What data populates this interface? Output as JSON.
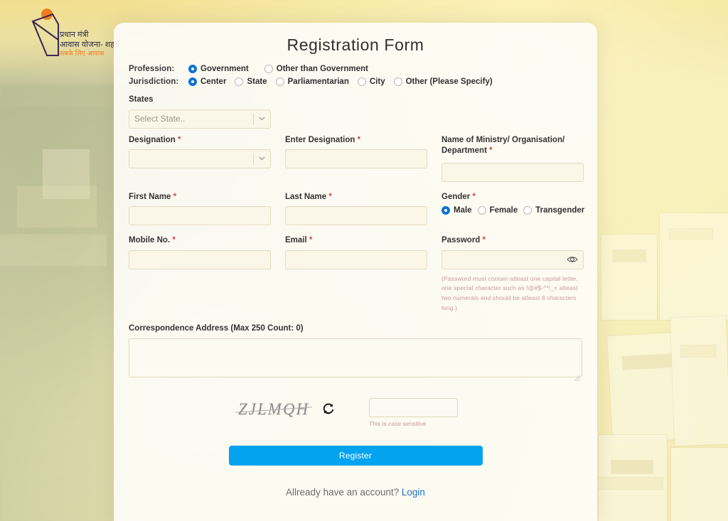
{
  "logo": {
    "name": "pmay-logo",
    "line1": "प्रधान मंत्री",
    "line2": "आवास योजना- शहरी",
    "line3": "सबके लिए आवास"
  },
  "title": "Registration  Form",
  "profession": {
    "label": "Profession:",
    "options": [
      {
        "label": "Government",
        "selected": true
      },
      {
        "label": "Other than Government",
        "selected": false
      }
    ]
  },
  "jurisdiction": {
    "label": "Jurisdiction:",
    "options": [
      {
        "label": "Center",
        "selected": true
      },
      {
        "label": "State",
        "selected": false
      },
      {
        "label": "Parliamentarian",
        "selected": false
      },
      {
        "label": "City",
        "selected": false
      },
      {
        "label": "Other (Please Specify)",
        "selected": false
      }
    ]
  },
  "states": {
    "label": "States",
    "placeholder": "Select State..",
    "value": ""
  },
  "designation": {
    "label": "Designation",
    "required": "*",
    "value": ""
  },
  "enter_designation": {
    "label": "Enter Designation",
    "required": "*",
    "value": "",
    "placeholder": ""
  },
  "ministry": {
    "label": "Name of Ministry/ Organisation/ Department",
    "required": "*",
    "value": "",
    "placeholder": ""
  },
  "first_name": {
    "label": "First Name",
    "required": "*",
    "value": "",
    "placeholder": ""
  },
  "last_name": {
    "label": "Last Name",
    "required": "*",
    "value": "",
    "placeholder": ""
  },
  "gender": {
    "label": "Gender",
    "required": "*",
    "options": [
      {
        "label": "Male",
        "selected": true
      },
      {
        "label": "Female",
        "selected": false
      },
      {
        "label": "Transgender",
        "selected": false
      }
    ]
  },
  "mobile": {
    "label": "Mobile No.",
    "required": "*",
    "value": "",
    "placeholder": ""
  },
  "email": {
    "label": "Email",
    "required": "*",
    "value": "",
    "placeholder": ""
  },
  "password": {
    "label": "Password",
    "required": "*",
    "value": "",
    "placeholder": "",
    "toggle_icon": "eye-icon",
    "hint": "(Password must contain atleast one capital letter, one special character such as !@#$-^*!_= atleast two numerals and should be atleast 8 characters long.)"
  },
  "address": {
    "label": "Correspondence Address (Max 250 Count: 0)",
    "max_count": 250,
    "current_count": 0,
    "value": "",
    "placeholder": ""
  },
  "captcha": {
    "text": "ZJLMQH",
    "refresh_icon": "refresh-icon",
    "value": "",
    "placeholder": "",
    "note": "This is case sensitive"
  },
  "submit": {
    "label": "Register"
  },
  "footer": {
    "text": "Allready have an account? ",
    "link": "Login"
  },
  "colors": {
    "accent": "#03a3ef",
    "radio_selected": "#0b72d8",
    "required_star": "#d64545",
    "hint_text": "#c99a9a",
    "input_bg": "#faf7e9",
    "card_bg": "#fdfcf6",
    "link": "#1a73c8"
  }
}
